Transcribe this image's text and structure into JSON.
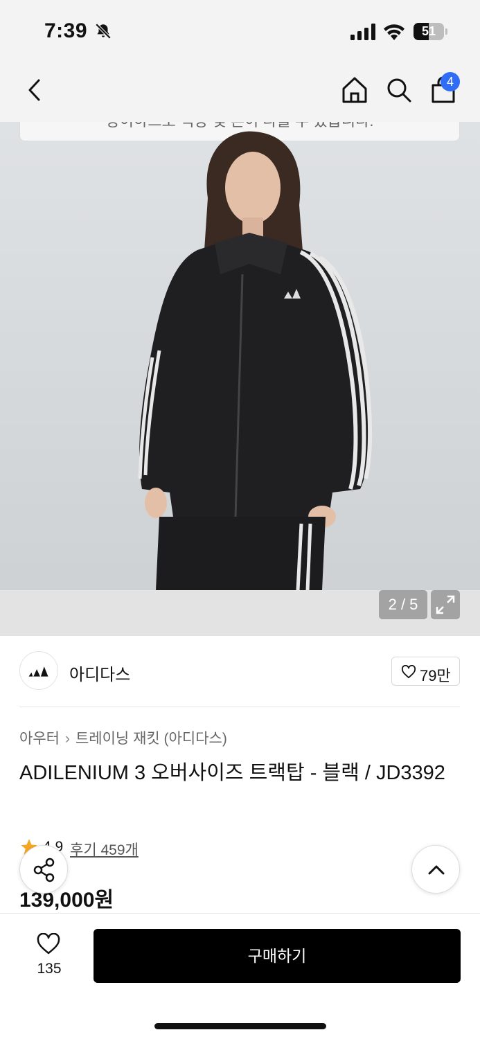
{
  "status": {
    "time": "7:39",
    "battery": "51",
    "battery_level": 0.51
  },
  "nav": {
    "cart_count": "4"
  },
  "image": {
    "notice": "상이하므로 색상 및 톤이 다를 수 있습니다.",
    "counter": "2 / 5",
    "current_index": 2,
    "total": 5
  },
  "brand": {
    "name": "아디다스",
    "like_count": "79만"
  },
  "product": {
    "breadcrumb": [
      "아우터",
      "트레이닝 재킷 (아디다스)"
    ],
    "title": "ADILENIUM 3 오버사이즈 트랙탑 - 블랙 / JD3392",
    "rating": "4.9",
    "review_label": "후기 459개",
    "price": "139,000원"
  },
  "bottom": {
    "wish_count": "135",
    "buy_label": "구매하기"
  },
  "colors": {
    "badge": "#2f6df6",
    "star": "#f5a623",
    "buy_button": "#000000"
  },
  "icons": [
    "bell-slash-icon",
    "signal-icon",
    "wifi-icon",
    "battery-icon",
    "back-chevron-icon",
    "home-icon",
    "search-icon",
    "shopping-bag-icon",
    "expand-icon",
    "adidas-logo",
    "heart-icon",
    "star-icon",
    "share-icon",
    "chevron-up-icon"
  ]
}
